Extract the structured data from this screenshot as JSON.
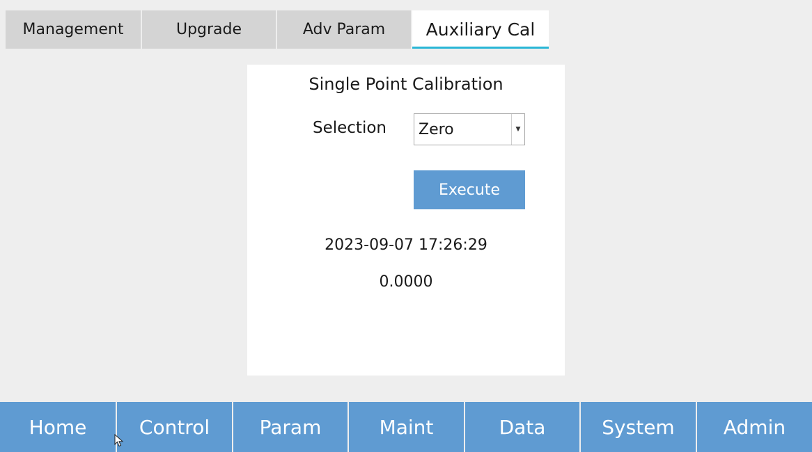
{
  "tabs": [
    {
      "label": "Management"
    },
    {
      "label": "Upgrade"
    },
    {
      "label": "Adv Param"
    },
    {
      "label": "Auxiliary Cal"
    }
  ],
  "panel": {
    "title": "Single Point Calibration",
    "selection_label": "Selection",
    "selection_value": "Zero",
    "execute_label": "Execute",
    "timestamp": "2023-09-07 17:26:29",
    "result": "0.0000"
  },
  "nav": [
    {
      "label": "Home"
    },
    {
      "label": "Control"
    },
    {
      "label": "Param"
    },
    {
      "label": "Maint"
    },
    {
      "label": "Data"
    },
    {
      "label": "System"
    },
    {
      "label": "Admin"
    }
  ],
  "colors": {
    "accent_blue": "#5f9bd2",
    "tab_underline": "#29b6d6",
    "background": "#eeeeee"
  },
  "icons": {
    "dropdown": "chevron-down-icon",
    "cursor": "mouse-pointer-icon"
  }
}
